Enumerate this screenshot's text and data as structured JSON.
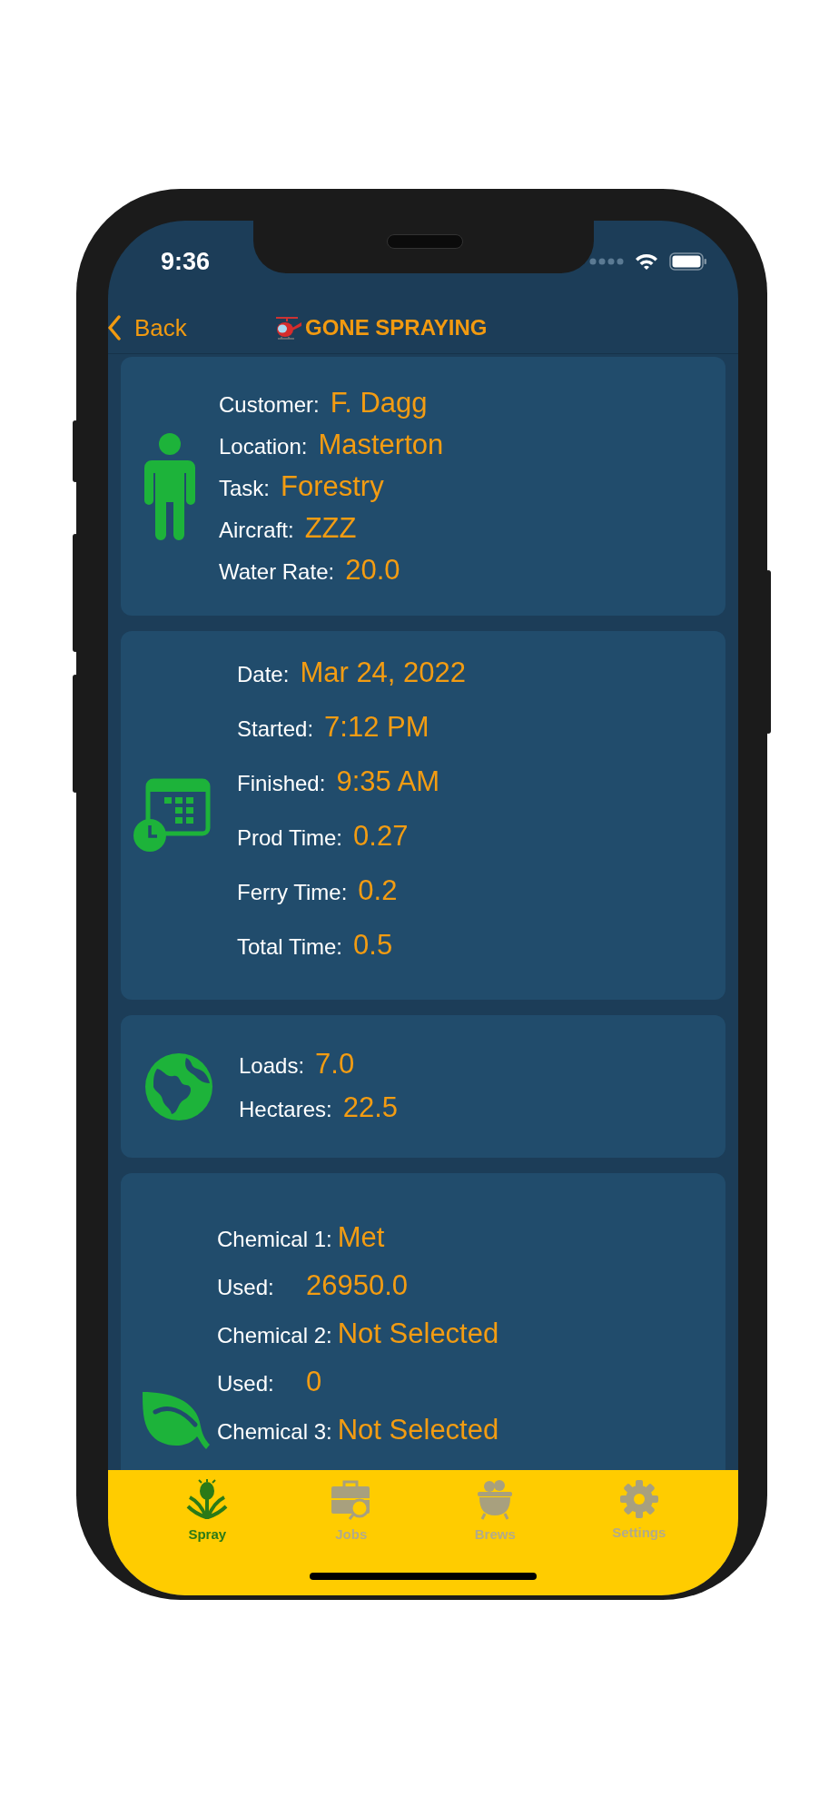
{
  "status_bar": {
    "time": "9:36"
  },
  "nav": {
    "back": "Back",
    "title": "GONE SPRAYING"
  },
  "cards": [
    {
      "kind": "person",
      "rows": [
        {
          "label": "Customer:",
          "value": "F. Dagg"
        },
        {
          "label": "Location:",
          "value": "Masterton"
        },
        {
          "label": "Task:",
          "value": "Forestry"
        },
        {
          "label": "Aircraft:",
          "value": "ZZZ"
        },
        {
          "label": "Water Rate:",
          "value": "20.0"
        }
      ]
    },
    {
      "kind": "calendar",
      "rows": [
        {
          "label": "Date:",
          "value": "Mar 24, 2022"
        },
        {
          "label": "Started:",
          "value": "7:12 PM"
        },
        {
          "label": "Finished:",
          "value": "9:35 AM"
        },
        {
          "label": "Prod Time:",
          "value": "0.27"
        },
        {
          "label": "Ferry Time:",
          "value": "0.2"
        },
        {
          "label": "Total Time:",
          "value": "0.5"
        }
      ]
    },
    {
      "kind": "globe",
      "rows": [
        {
          "label": "Loads:",
          "value": "7.0"
        },
        {
          "label": "Hectares:",
          "value": "22.5"
        }
      ]
    },
    {
      "kind": "leaf",
      "rows": [
        {
          "label": "Chemical 1:",
          "value": "Met"
        },
        {
          "label": "Used:",
          "value": "26950.0"
        },
        {
          "label": "Chemical 2:",
          "value": "Not Selected"
        },
        {
          "label": "Used:",
          "value": "0"
        },
        {
          "label": "Chemical 3:",
          "value": "Not Selected"
        }
      ]
    }
  ],
  "tabs": [
    {
      "label": "Spray",
      "kind": "thistle",
      "selected": true
    },
    {
      "label": "Jobs",
      "kind": "briefcase",
      "selected": false
    },
    {
      "label": "Brews",
      "kind": "cauldron",
      "selected": false
    },
    {
      "label": "Settings",
      "kind": "gear",
      "selected": false
    }
  ]
}
